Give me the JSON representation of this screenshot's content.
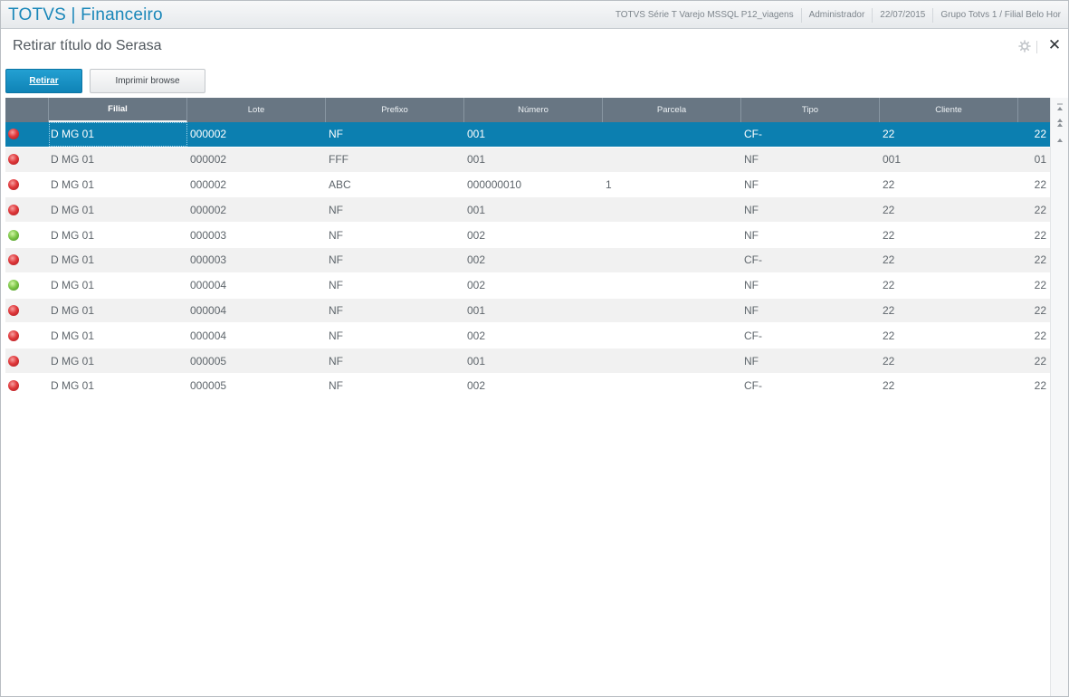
{
  "app": {
    "brand": "TOTVS | Financeiro",
    "environment": "TOTVS Série T Varejo MSSQL P12_viagens",
    "user": "Administrador",
    "date": "22/07/2015",
    "company": "Grupo Totvs 1 / Filial Belo Hor"
  },
  "page": {
    "title": "Retirar título do Serasa"
  },
  "toolbar": {
    "retirar_label": "Retirar",
    "imprimir_label": "Imprimir browse"
  },
  "grid": {
    "columns": [
      "",
      "Filial",
      "Lote",
      "Prefixo",
      "Número",
      "Parcela",
      "Tipo",
      "Cliente",
      ""
    ],
    "rows": [
      {
        "status": "red",
        "filial": "D MG 01",
        "lote": "000002",
        "prefixo": "NF",
        "numero": "001",
        "parcela": "",
        "tipo": "CF-",
        "cliente": "22",
        "loja": "22",
        "selected": true
      },
      {
        "status": "red",
        "filial": "D MG 01",
        "lote": "000002",
        "prefixo": "FFF",
        "numero": "001",
        "parcela": "",
        "tipo": "NF",
        "cliente": "001",
        "loja": "01"
      },
      {
        "status": "red",
        "filial": "D MG 01",
        "lote": "000002",
        "prefixo": "ABC",
        "numero": "000000010",
        "parcela": "1",
        "tipo": "NF",
        "cliente": "22",
        "loja": "22"
      },
      {
        "status": "red",
        "filial": "D MG 01",
        "lote": "000002",
        "prefixo": "NF",
        "numero": "001",
        "parcela": "",
        "tipo": "NF",
        "cliente": "22",
        "loja": "22"
      },
      {
        "status": "green",
        "filial": "D MG 01",
        "lote": "000003",
        "prefixo": "NF",
        "numero": "002",
        "parcela": "",
        "tipo": "NF",
        "cliente": "22",
        "loja": "22"
      },
      {
        "status": "red",
        "filial": "D MG 01",
        "lote": "000003",
        "prefixo": "NF",
        "numero": "002",
        "parcela": "",
        "tipo": "CF-",
        "cliente": "22",
        "loja": "22"
      },
      {
        "status": "green",
        "filial": "D MG 01",
        "lote": "000004",
        "prefixo": "NF",
        "numero": "002",
        "parcela": "",
        "tipo": "NF",
        "cliente": "22",
        "loja": "22"
      },
      {
        "status": "red",
        "filial": "D MG 01",
        "lote": "000004",
        "prefixo": "NF",
        "numero": "001",
        "parcela": "",
        "tipo": "NF",
        "cliente": "22",
        "loja": "22"
      },
      {
        "status": "red",
        "filial": "D MG 01",
        "lote": "000004",
        "prefixo": "NF",
        "numero": "002",
        "parcela": "",
        "tipo": "CF-",
        "cliente": "22",
        "loja": "22"
      },
      {
        "status": "red",
        "filial": "D MG 01",
        "lote": "000005",
        "prefixo": "NF",
        "numero": "001",
        "parcela": "",
        "tipo": "NF",
        "cliente": "22",
        "loja": "22"
      },
      {
        "status": "red",
        "filial": "D MG 01",
        "lote": "000005",
        "prefixo": "NF",
        "numero": "002",
        "parcela": "",
        "tipo": "CF-",
        "cliente": "22",
        "loja": "22"
      }
    ]
  },
  "icons": {
    "gear": "gear-icon",
    "close": "close-icon",
    "scroll_top": "scroll-top-icon",
    "scroll_up": "scroll-up-icon"
  },
  "colors": {
    "brand": "#1a87b9",
    "primary_button": "#0f83b6",
    "header": "#687683",
    "selected_row": "#0c7fb0",
    "status_red": "#e0393c",
    "status_green": "#7fc84a"
  }
}
